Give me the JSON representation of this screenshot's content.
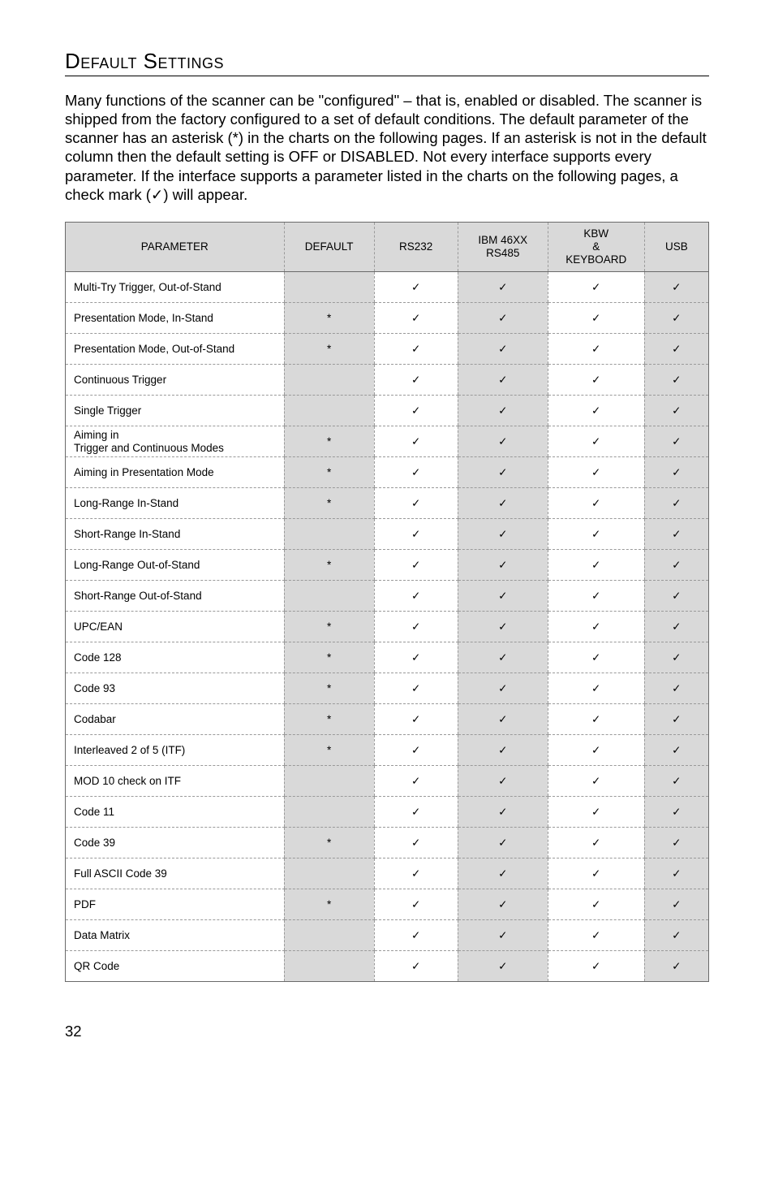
{
  "title": "Default Settings",
  "intro": "Many functions of the scanner can be \"configured\" – that is, enabled or disabled. The scanner is shipped from the factory configured to a set of default conditions. The default parameter of the scanner has an asterisk (*) in the charts on the following pages.  If an asterisk is not in the default column then the default setting is OFF or DISABLED.  Not every interface supports every parameter.  If the interface supports a parameter listed in the charts on the following pages, a check mark (✓) will appear.",
  "columns": {
    "parameter": "PARAMETER",
    "default": "DEFAULT",
    "rs232": "RS232",
    "ibm": "IBM 46XX\nRS485",
    "kbw": "KBW\n&\nKEYBOARD",
    "usb": "USB"
  },
  "rows": [
    {
      "param": "Multi-Try Trigger, Out-of-Stand",
      "default": "",
      "rs232": "✓",
      "ibm": "✓",
      "kbw": "✓",
      "usb": "✓"
    },
    {
      "param": "Presentation Mode,  In-Stand",
      "default": "*",
      "rs232": "✓",
      "ibm": "✓",
      "kbw": "✓",
      "usb": "✓"
    },
    {
      "param": "Presentation Mode,  Out-of-Stand",
      "default": "*",
      "rs232": "✓",
      "ibm": "✓",
      "kbw": "✓",
      "usb": "✓"
    },
    {
      "param": "Continuous Trigger",
      "default": "",
      "rs232": "✓",
      "ibm": "✓",
      "kbw": "✓",
      "usb": "✓"
    },
    {
      "param": "Single Trigger",
      "default": "",
      "rs232": "✓",
      "ibm": "✓",
      "kbw": "✓",
      "usb": "✓"
    },
    {
      "param": "Aiming in\nTrigger and Continuous Modes",
      "default": "*",
      "rs232": "✓",
      "ibm": "✓",
      "kbw": "✓",
      "usb": "✓"
    },
    {
      "param": "Aiming in Presentation Mode",
      "default": "*",
      "rs232": "✓",
      "ibm": "✓",
      "kbw": "✓",
      "usb": "✓"
    },
    {
      "param": "Long-Range In-Stand",
      "default": "*",
      "rs232": "✓",
      "ibm": "✓",
      "kbw": "✓",
      "usb": "✓"
    },
    {
      "param": "Short-Range In-Stand",
      "default": "",
      "rs232": "✓",
      "ibm": "✓",
      "kbw": "✓",
      "usb": "✓"
    },
    {
      "param": "Long-Range Out-of-Stand",
      "default": "*",
      "rs232": "✓",
      "ibm": "✓",
      "kbw": "✓",
      "usb": "✓"
    },
    {
      "param": "Short-Range Out-of-Stand",
      "default": "",
      "rs232": "✓",
      "ibm": "✓",
      "kbw": "✓",
      "usb": "✓"
    },
    {
      "param": "UPC/EAN",
      "default": "*",
      "rs232": "✓",
      "ibm": "✓",
      "kbw": "✓",
      "usb": "✓"
    },
    {
      "param": "Code 128",
      "default": "*",
      "rs232": "✓",
      "ibm": "✓",
      "kbw": "✓",
      "usb": "✓"
    },
    {
      "param": "Code 93",
      "default": "*",
      "rs232": "✓",
      "ibm": "✓",
      "kbw": "✓",
      "usb": "✓"
    },
    {
      "param": "Codabar",
      "default": "*",
      "rs232": "✓",
      "ibm": "✓",
      "kbw": "✓",
      "usb": "✓"
    },
    {
      "param": "Interleaved 2 of 5 (ITF)",
      "default": "*",
      "rs232": "✓",
      "ibm": "✓",
      "kbw": "✓",
      "usb": "✓"
    },
    {
      "param": "MOD 10 check on ITF",
      "default": "",
      "rs232": "✓",
      "ibm": "✓",
      "kbw": "✓",
      "usb": "✓"
    },
    {
      "param": "Code 11",
      "default": "",
      "rs232": "✓",
      "ibm": "✓",
      "kbw": "✓",
      "usb": "✓"
    },
    {
      "param": "Code 39",
      "default": "*",
      "rs232": "✓",
      "ibm": "✓",
      "kbw": "✓",
      "usb": "✓"
    },
    {
      "param": "Full ASCII Code 39",
      "default": "",
      "rs232": "✓",
      "ibm": "✓",
      "kbw": "✓",
      "usb": "✓"
    },
    {
      "param": "PDF",
      "default": "*",
      "rs232": "✓",
      "ibm": "✓",
      "kbw": "✓",
      "usb": "✓"
    },
    {
      "param": "Data Matrix",
      "default": "",
      "rs232": "✓",
      "ibm": "✓",
      "kbw": "✓",
      "usb": "✓"
    },
    {
      "param": "QR Code",
      "default": "",
      "rs232": "✓",
      "ibm": "✓",
      "kbw": "✓",
      "usb": "✓"
    }
  ],
  "pageNumber": "32"
}
